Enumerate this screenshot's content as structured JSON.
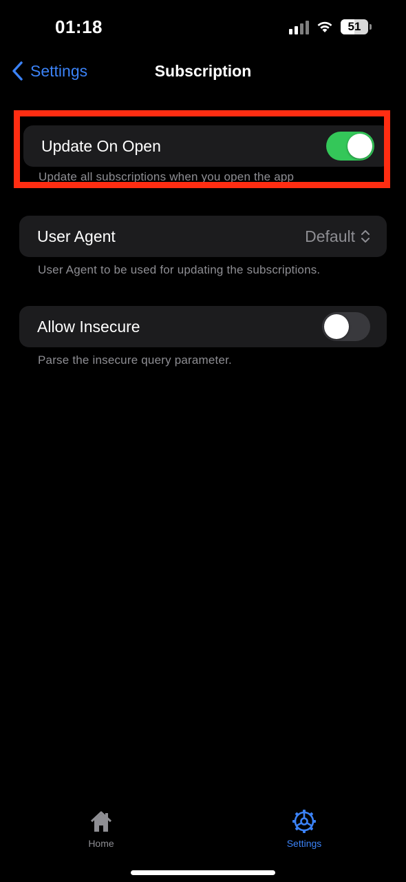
{
  "status_bar": {
    "time": "01:18",
    "battery_level": "51",
    "battery_fraction": 0.51
  },
  "nav": {
    "back_label": "Settings",
    "title": "Subscription"
  },
  "update_on_open": {
    "label": "Update On Open",
    "enabled": true,
    "footnote": "Update all subscriptions when you open the app"
  },
  "user_agent": {
    "label": "User Agent",
    "value": "Default",
    "footnote": "User Agent to be used for updating the subscriptions."
  },
  "allow_insecure": {
    "label": "Allow Insecure",
    "enabled": false,
    "footnote": "Parse the insecure query parameter."
  },
  "tabs": [
    {
      "label": "Home",
      "icon": "house-icon",
      "selected": false
    },
    {
      "label": "Settings",
      "icon": "gear-icon",
      "selected": true
    }
  ],
  "colors": {
    "accent": "#3b82f6",
    "toggle_on": "#34c759",
    "highlight": "#ff2d12"
  }
}
